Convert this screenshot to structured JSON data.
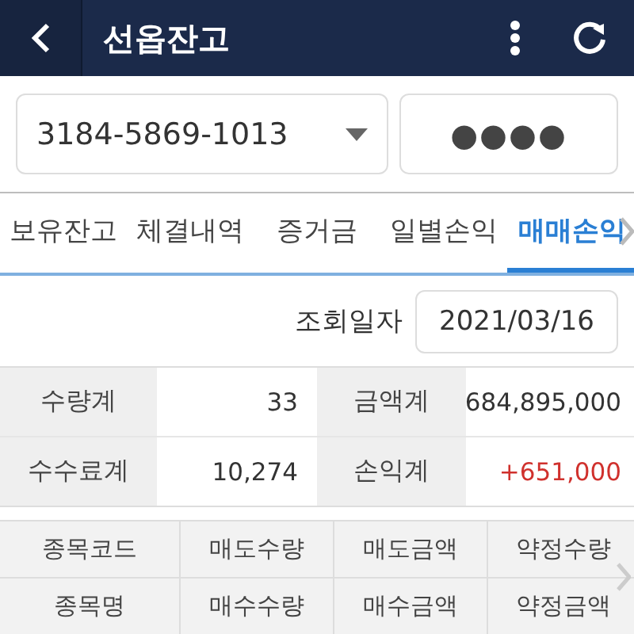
{
  "header": {
    "title": "선옵잔고"
  },
  "account": {
    "number": "3184-5869-1013",
    "password": "●●●●"
  },
  "tabs": [
    {
      "label": "보유잔고",
      "selected": false
    },
    {
      "label": "체결내역",
      "selected": false
    },
    {
      "label": "증거금",
      "selected": false
    },
    {
      "label": "일별손익",
      "selected": false
    },
    {
      "label": "매매손익",
      "selected": true
    }
  ],
  "query": {
    "label": "조회일자",
    "date": "2021/03/16"
  },
  "summary": [
    {
      "label": "수량계",
      "value": "33",
      "color": "#333333"
    },
    {
      "label": "금액계",
      "value": "684,895,000",
      "color": "#333333"
    },
    {
      "label": "수수료계",
      "value": "10,274",
      "color": "#333333"
    },
    {
      "label": "손익계",
      "value": "+651,000",
      "color": "#d0312d"
    }
  ],
  "column_header_rows": [
    {
      "cells": [
        "종목코드",
        "매도수량",
        "매도금액",
        "약정수량"
      ]
    },
    {
      "cells": [
        "종목명",
        "매수수량",
        "매수금액",
        "약정금액"
      ]
    }
  ]
}
